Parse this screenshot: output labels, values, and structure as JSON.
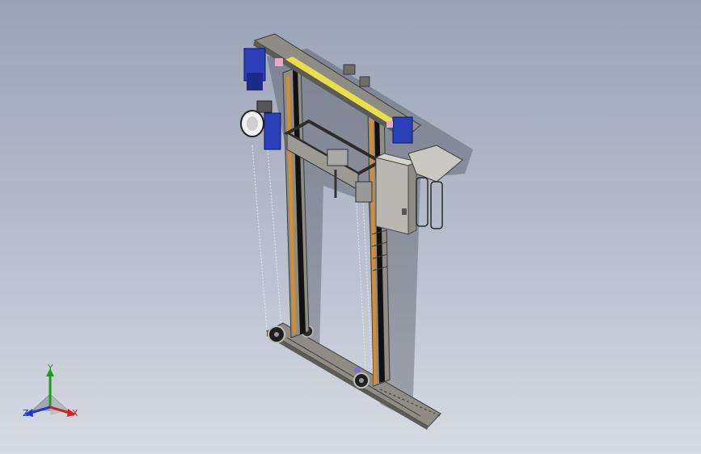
{
  "viewport": {
    "background_top": "#9aa3b6",
    "background_bottom": "#d7dbe3",
    "model_name": "gantry-lift-frame",
    "colors": {
      "frame": "#8f8c86",
      "frame_dark": "#5d5b57",
      "accent_orange": "#d98c2b",
      "yellow_beam": "#e8df4a",
      "motor_blue": "#2b3fb8",
      "cabinet": "#b9b7b1",
      "shadow": "#3c3f48"
    }
  },
  "triad": {
    "x_label": "X",
    "y_label": "Y",
    "z_label": "Z",
    "x_color": "#d42020",
    "y_color": "#1a9e1a",
    "z_color": "#2436c8"
  }
}
